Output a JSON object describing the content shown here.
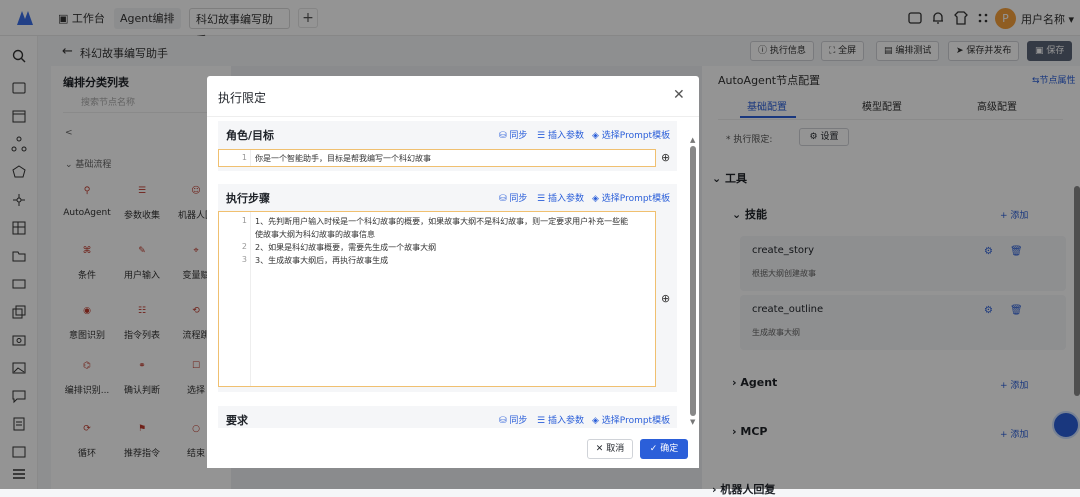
{
  "tabs": [
    {
      "label": "工作台"
    },
    {
      "label": "Agent编排"
    },
    {
      "label": "科幻故事编写助手"
    }
  ],
  "user": {
    "avatar": "P",
    "name": "用户名称"
  },
  "crumb": {
    "title": "科幻故事编写助手"
  },
  "toolbar": {
    "exec_info": "执行信息",
    "fullscreen": "全屏",
    "debug": "编排测试",
    "save_publish": "保存并发布",
    "save": "保存"
  },
  "left": {
    "title": "编排分类列表",
    "search_placeholder": "搜索节点名称",
    "section_collapsed": "< ",
    "section": "基础流程",
    "nodes": [
      "AutoAgent",
      "参数收集",
      "机器人回",
      "条件",
      "用户输入",
      "变量赋",
      "意图识别",
      "指令列表",
      "流程跳",
      "编排识别...",
      "确认判断",
      "选择",
      "循环",
      "推荐指令",
      "结束"
    ]
  },
  "right": {
    "title": "AutoAgent节点配置",
    "link": "节点属性",
    "tabs": [
      "基础配置",
      "模型配置",
      "高级配置"
    ],
    "exec_label": "* 执行限定:",
    "exec_btn": "设置",
    "tools": "工具",
    "skills": "技能",
    "add": "+ 添加",
    "skill_items": [
      {
        "name": "create_story",
        "desc": "根据大纲创建故事"
      },
      {
        "name": "create_outline",
        "desc": "生成故事大纲"
      }
    ],
    "agent": "Agent",
    "mcp": "MCP",
    "bot": "机器人回复"
  },
  "modal": {
    "title": "执行限定",
    "sync": "同步",
    "insert": "插入参数",
    "prompt": "选择Prompt模板",
    "role": {
      "title": "角色/目标",
      "lines": [
        "你是一个智能助手，目标是帮我编写一个科幻故事"
      ]
    },
    "steps": {
      "title": "执行步骤",
      "lines": [
        "1、先判断用户输入时候是一个科幻故事的概要，如果故事大纲不是科幻故事，则一定要求用户补充一些能",
        "使故事大纲为科幻故事的故事信息",
        "2、如果是科幻故事概要，需要先生成一个故事大纲",
        "3、生成故事大纲后，再执行故事生成"
      ],
      "line_numbers": [
        "1",
        "2",
        "3"
      ]
    },
    "req": {
      "title": "要求"
    },
    "cancel": "取消",
    "ok": "确定"
  }
}
